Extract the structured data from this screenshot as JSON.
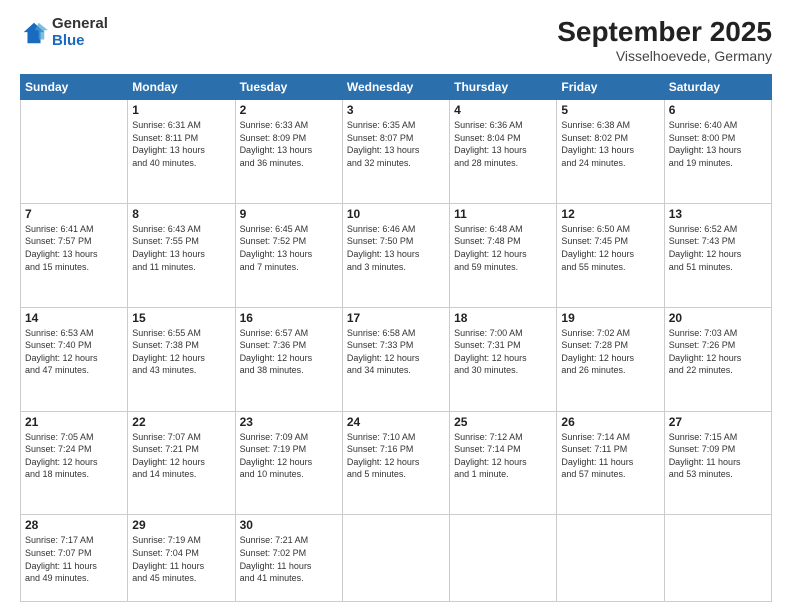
{
  "header": {
    "logo_general": "General",
    "logo_blue": "Blue",
    "month_title": "September 2025",
    "location": "Visselhoevede, Germany"
  },
  "days_of_week": [
    "Sunday",
    "Monday",
    "Tuesday",
    "Wednesday",
    "Thursday",
    "Friday",
    "Saturday"
  ],
  "weeks": [
    [
      {
        "day": "",
        "info": ""
      },
      {
        "day": "1",
        "info": "Sunrise: 6:31 AM\nSunset: 8:11 PM\nDaylight: 13 hours\nand 40 minutes."
      },
      {
        "day": "2",
        "info": "Sunrise: 6:33 AM\nSunset: 8:09 PM\nDaylight: 13 hours\nand 36 minutes."
      },
      {
        "day": "3",
        "info": "Sunrise: 6:35 AM\nSunset: 8:07 PM\nDaylight: 13 hours\nand 32 minutes."
      },
      {
        "day": "4",
        "info": "Sunrise: 6:36 AM\nSunset: 8:04 PM\nDaylight: 13 hours\nand 28 minutes."
      },
      {
        "day": "5",
        "info": "Sunrise: 6:38 AM\nSunset: 8:02 PM\nDaylight: 13 hours\nand 24 minutes."
      },
      {
        "day": "6",
        "info": "Sunrise: 6:40 AM\nSunset: 8:00 PM\nDaylight: 13 hours\nand 19 minutes."
      }
    ],
    [
      {
        "day": "7",
        "info": "Sunrise: 6:41 AM\nSunset: 7:57 PM\nDaylight: 13 hours\nand 15 minutes."
      },
      {
        "day": "8",
        "info": "Sunrise: 6:43 AM\nSunset: 7:55 PM\nDaylight: 13 hours\nand 11 minutes."
      },
      {
        "day": "9",
        "info": "Sunrise: 6:45 AM\nSunset: 7:52 PM\nDaylight: 13 hours\nand 7 minutes."
      },
      {
        "day": "10",
        "info": "Sunrise: 6:46 AM\nSunset: 7:50 PM\nDaylight: 13 hours\nand 3 minutes."
      },
      {
        "day": "11",
        "info": "Sunrise: 6:48 AM\nSunset: 7:48 PM\nDaylight: 12 hours\nand 59 minutes."
      },
      {
        "day": "12",
        "info": "Sunrise: 6:50 AM\nSunset: 7:45 PM\nDaylight: 12 hours\nand 55 minutes."
      },
      {
        "day": "13",
        "info": "Sunrise: 6:52 AM\nSunset: 7:43 PM\nDaylight: 12 hours\nand 51 minutes."
      }
    ],
    [
      {
        "day": "14",
        "info": "Sunrise: 6:53 AM\nSunset: 7:40 PM\nDaylight: 12 hours\nand 47 minutes."
      },
      {
        "day": "15",
        "info": "Sunrise: 6:55 AM\nSunset: 7:38 PM\nDaylight: 12 hours\nand 43 minutes."
      },
      {
        "day": "16",
        "info": "Sunrise: 6:57 AM\nSunset: 7:36 PM\nDaylight: 12 hours\nand 38 minutes."
      },
      {
        "day": "17",
        "info": "Sunrise: 6:58 AM\nSunset: 7:33 PM\nDaylight: 12 hours\nand 34 minutes."
      },
      {
        "day": "18",
        "info": "Sunrise: 7:00 AM\nSunset: 7:31 PM\nDaylight: 12 hours\nand 30 minutes."
      },
      {
        "day": "19",
        "info": "Sunrise: 7:02 AM\nSunset: 7:28 PM\nDaylight: 12 hours\nand 26 minutes."
      },
      {
        "day": "20",
        "info": "Sunrise: 7:03 AM\nSunset: 7:26 PM\nDaylight: 12 hours\nand 22 minutes."
      }
    ],
    [
      {
        "day": "21",
        "info": "Sunrise: 7:05 AM\nSunset: 7:24 PM\nDaylight: 12 hours\nand 18 minutes."
      },
      {
        "day": "22",
        "info": "Sunrise: 7:07 AM\nSunset: 7:21 PM\nDaylight: 12 hours\nand 14 minutes."
      },
      {
        "day": "23",
        "info": "Sunrise: 7:09 AM\nSunset: 7:19 PM\nDaylight: 12 hours\nand 10 minutes."
      },
      {
        "day": "24",
        "info": "Sunrise: 7:10 AM\nSunset: 7:16 PM\nDaylight: 12 hours\nand 5 minutes."
      },
      {
        "day": "25",
        "info": "Sunrise: 7:12 AM\nSunset: 7:14 PM\nDaylight: 12 hours\nand 1 minute."
      },
      {
        "day": "26",
        "info": "Sunrise: 7:14 AM\nSunset: 7:11 PM\nDaylight: 11 hours\nand 57 minutes."
      },
      {
        "day": "27",
        "info": "Sunrise: 7:15 AM\nSunset: 7:09 PM\nDaylight: 11 hours\nand 53 minutes."
      }
    ],
    [
      {
        "day": "28",
        "info": "Sunrise: 7:17 AM\nSunset: 7:07 PM\nDaylight: 11 hours\nand 49 minutes."
      },
      {
        "day": "29",
        "info": "Sunrise: 7:19 AM\nSunset: 7:04 PM\nDaylight: 11 hours\nand 45 minutes."
      },
      {
        "day": "30",
        "info": "Sunrise: 7:21 AM\nSunset: 7:02 PM\nDaylight: 11 hours\nand 41 minutes."
      },
      {
        "day": "",
        "info": ""
      },
      {
        "day": "",
        "info": ""
      },
      {
        "day": "",
        "info": ""
      },
      {
        "day": "",
        "info": ""
      }
    ]
  ]
}
